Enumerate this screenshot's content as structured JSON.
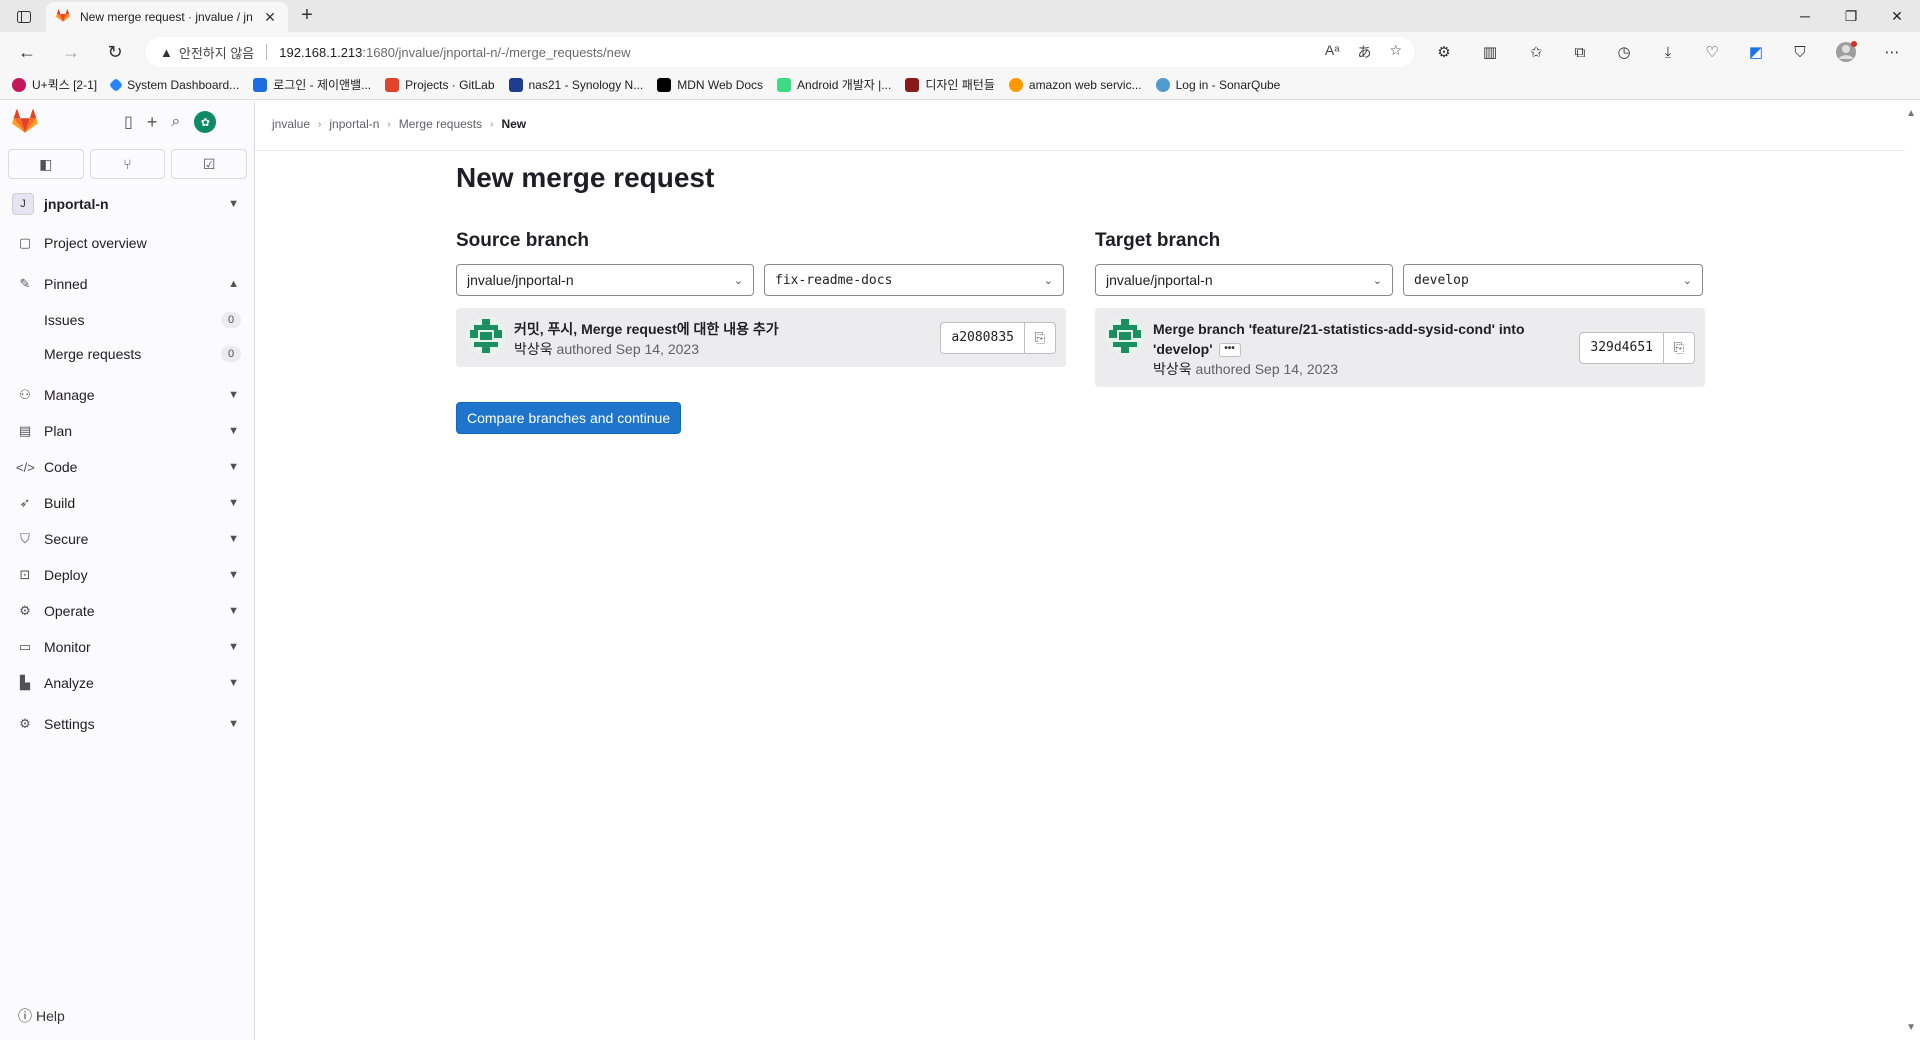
{
  "browser": {
    "tab_title": "New merge request · jnvalue / jn",
    "url_warning": "안전하지 않음",
    "url_host": "192.168.1.213",
    "url_path": ":1680/jnvalue/jnportal-n/-/merge_requests/new",
    "bookmarks": [
      {
        "label": "U+퀵스 [2-1]",
        "color": "#c2185b"
      },
      {
        "label": "System Dashboard...",
        "color": "#2684ff"
      },
      {
        "label": "로그인 - 제이앤밸...",
        "color": "#1d6ce0"
      },
      {
        "label": "Projects · GitLab",
        "color": "#e24329"
      },
      {
        "label": "nas21 - Synology N...",
        "color": "#1d3e8f"
      },
      {
        "label": "MDN Web Docs",
        "color": "#000000"
      },
      {
        "label": "Android 개발자 |...",
        "color": "#3ddc84"
      },
      {
        "label": "디자인 패턴들",
        "color": "#8b1a1a"
      },
      {
        "label": "amazon web servic...",
        "color": "#ff9900"
      },
      {
        "label": "Log in - SonarQube",
        "color": "#4e9bcd"
      }
    ]
  },
  "sidebar": {
    "project_initial": "J",
    "project_name": "jnportal-n",
    "overview": "Project overview",
    "pinned": "Pinned",
    "pinned_items": [
      {
        "label": "Issues",
        "count": "0"
      },
      {
        "label": "Merge requests",
        "count": "0"
      }
    ],
    "sections": [
      "Manage",
      "Plan",
      "Code",
      "Build",
      "Secure",
      "Deploy",
      "Operate",
      "Monitor",
      "Analyze",
      "Settings"
    ],
    "help": "Help"
  },
  "breadcrumb": [
    "jnvalue",
    "jnportal-n",
    "Merge requests",
    "New"
  ],
  "main": {
    "title": "New merge request",
    "source": {
      "heading": "Source branch",
      "project": "jnvalue/jnportal-n",
      "branch": "fix-readme-docs",
      "commit_title": "커밋, 푸시, Merge request에 대한 내용 추가",
      "author": "박상욱",
      "authored": "authored Sep 14, 2023",
      "sha": "a2080835"
    },
    "target": {
      "heading": "Target branch",
      "project": "jnvalue/jnportal-n",
      "branch": "develop",
      "commit_title": "Merge branch 'feature/21-statistics-add-sysid-cond' into 'develop'",
      "author": "박상욱",
      "authored": "authored Sep 14, 2023",
      "sha": "329d4651"
    },
    "compare_button": "Compare branches and continue"
  },
  "colors": {
    "accent": "#1f75cb",
    "gitlab_orange": "#e24329"
  }
}
